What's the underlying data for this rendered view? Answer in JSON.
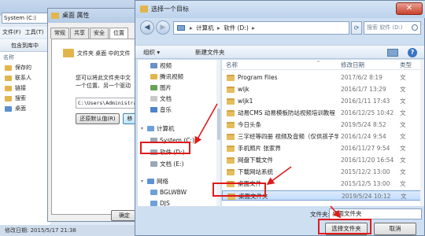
{
  "background": {
    "address": "System (C:)",
    "menu": [
      "文件(F)",
      "工具(T)"
    ],
    "toolbar_label": "包含到库中",
    "nav_header": "名称",
    "nav_items": [
      "保存的",
      "联系人",
      "链接",
      "搜索",
      "桌面"
    ],
    "status_text": "修改日期: 2015/5/17 21:38"
  },
  "props": {
    "title": "桌面 属性",
    "tabs": [
      "常规",
      "共享",
      "安全",
      "位置"
    ],
    "desc1": "文件夹 桌面 中的文件",
    "desc2_line1": "您可以将此文件夹中文",
    "desc2_line2": "一个位置、另一个驱动",
    "path": "C:\\Users\\Administrator",
    "restore_label": "还原默认值(R)",
    "move_label": "移",
    "ok_label": "确定"
  },
  "dialog": {
    "title": "选择一个目标",
    "close_symbol": "✕",
    "breadcrumb": [
      "计算机",
      "软件 (D:)"
    ],
    "search_placeholder": "搜索 软件 (D:)",
    "toolbar": {
      "organize": "组织 ▾",
      "new_folder": "新建文件夹"
    },
    "nav": [
      {
        "label": "视频",
        "icon": "video-library-icon",
        "color": "#6a8fc9"
      },
      {
        "label": "腾讯视频",
        "icon": "folder-icon",
        "color": "#e2b54c"
      },
      {
        "label": "图片",
        "icon": "pictures-library-icon",
        "color": "#6aa05a"
      },
      {
        "label": "文档",
        "icon": "documents-library-icon",
        "color": "#c9c9c9"
      },
      {
        "label": "音乐",
        "icon": "music-library-icon",
        "color": "#4d83c8"
      },
      {
        "label": "计算机",
        "icon": "computer-icon",
        "color": "#6f9fd8"
      },
      {
        "label": "System (C:)",
        "icon": "drive-icon",
        "color": "#9aa7b6"
      },
      {
        "label": "软件 (D:)",
        "icon": "drive-icon",
        "color": "#9aa7b6"
      },
      {
        "label": "文档 (E:)",
        "icon": "drive-icon",
        "color": "#9aa7b6"
      },
      {
        "label": "网络",
        "icon": "network-icon",
        "color": "#5f92d3"
      },
      {
        "label": "BGLWBW",
        "icon": "network-computer-icon",
        "color": "#6f9fd8"
      },
      {
        "label": "DJS",
        "icon": "network-computer-icon",
        "color": "#6f9fd8"
      }
    ],
    "columns": {
      "name": "名称",
      "date": "修改日期",
      "type": "类型",
      "sort_indicator": "^"
    },
    "files": [
      {
        "name": "Program Files",
        "date": "2017/6/2 8:19",
        "type": "文"
      },
      {
        "name": "wljk",
        "date": "2016/1/7 13:29",
        "type": "文"
      },
      {
        "name": "wljk1",
        "date": "2016/1/11 17:43",
        "type": "文"
      },
      {
        "name": "动易CMS 动易模板防站视频培训教程",
        "date": "2016/12/25 10:42",
        "type": "文"
      },
      {
        "name": "今日头条",
        "date": "2019/5/24 8:52",
        "type": "文"
      },
      {
        "name": "三字经等四册 视频及音频（仅供孩子学",
        "date": "2016/1/24 9:54",
        "type": "文"
      },
      {
        "name": "手机照片 张家界",
        "date": "2016/11/27 9:54",
        "type": "文"
      },
      {
        "name": "网盘下载文件",
        "date": "2016/11/20 16:54",
        "type": "文"
      },
      {
        "name": "下载网站系统",
        "date": "2015/12/2 13:00",
        "type": "文"
      },
      {
        "name": "桌面文件",
        "date": "2015/12/5 13:00",
        "type": "文"
      },
      {
        "name": "桌面文件夹",
        "date": "2019/5/24 10:12",
        "type": "文"
      }
    ],
    "selected_index": 10,
    "folder_label": "文件夹:",
    "folder_value": "桌面文件夹",
    "select_button": "选择文件夹",
    "cancel_button": "取消",
    "help_symbol": "?"
  },
  "colors": {
    "highlight": "#e01a1a",
    "selection": "#c1dcfc"
  }
}
